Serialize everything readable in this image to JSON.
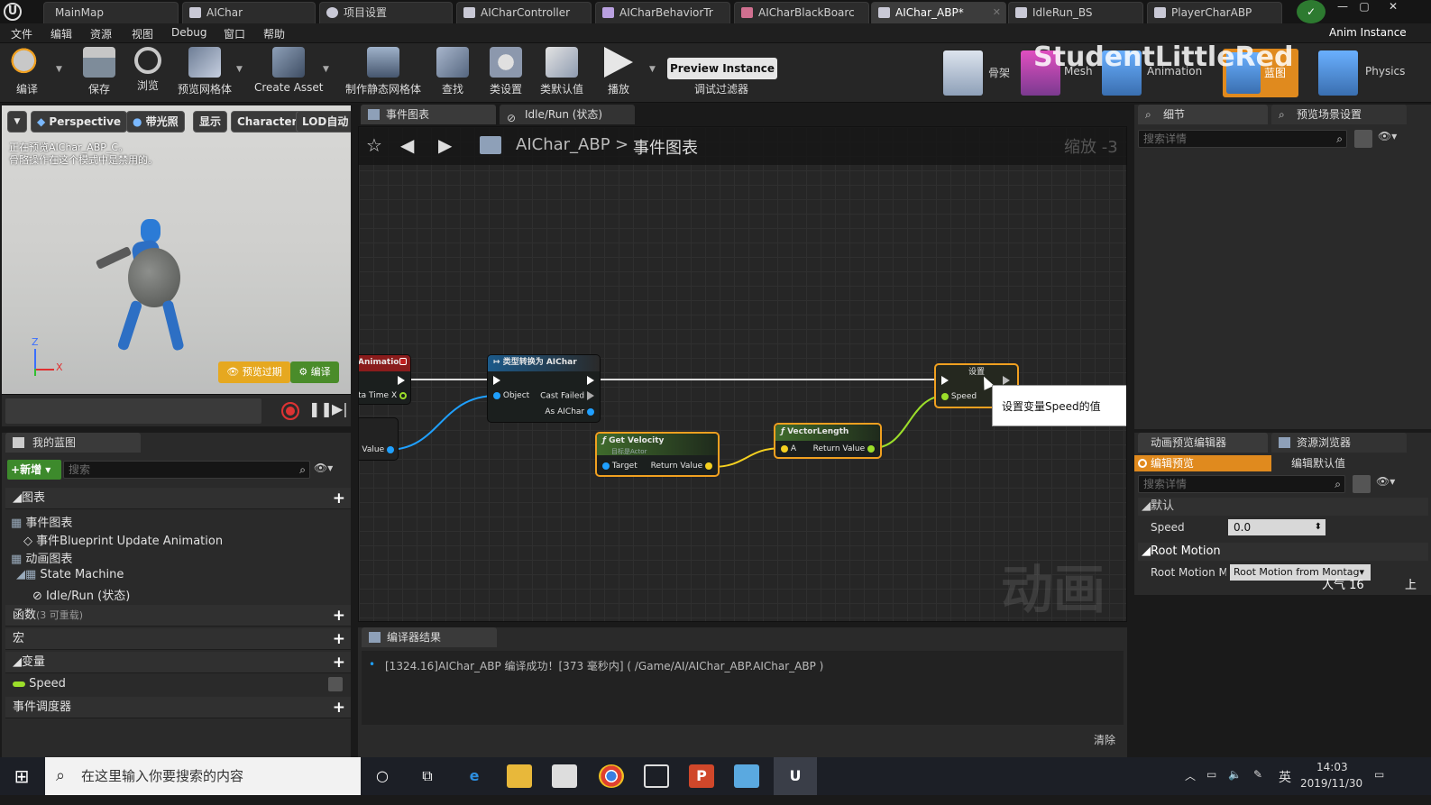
{
  "doc_tabs": [
    {
      "label": "MainMap"
    },
    {
      "label": "AIChar"
    },
    {
      "label": "项目设置"
    },
    {
      "label": "AICharController"
    },
    {
      "label": "AICharBehaviorTr"
    },
    {
      "label": "AICharBlackBoarc"
    },
    {
      "label": "AIChar_ABP*"
    },
    {
      "label": "IdleRun_BS"
    },
    {
      "label": "PlayerCharABP"
    }
  ],
  "menu": [
    "文件",
    "编辑",
    "资源",
    "视图",
    "Debug",
    "窗口",
    "帮助"
  ],
  "window_right_label": "Anim Instance",
  "watermark_text": "StudentLittleRed",
  "toolbar": {
    "buttons": [
      "编译",
      "保存",
      "浏览",
      "预览网格体",
      "Create Asset",
      "制作静态网格体",
      "查找",
      "类设置",
      "类默认值",
      "播放"
    ],
    "preview_instance": "Preview Instance ▾",
    "debug_filter": "调试过滤器",
    "modes": [
      "骨架",
      "Mesh",
      "Animation",
      "蓝图",
      "Physics"
    ]
  },
  "viewport": {
    "buttons": [
      "Perspective",
      "带光照",
      "显示",
      "Character",
      "LOD自动"
    ],
    "info_line1": "正在预览AIChar_ABP_C。",
    "info_line2": "骨骼操作在这个模式中是禁用的。",
    "axis_z": "Z",
    "axis_x": "X",
    "preview_expired": "预览过期",
    "compile_badge": "编译"
  },
  "my_blueprint": {
    "tab": "我的蓝图",
    "new_button": "新增 ▾",
    "search_placeholder": "搜索",
    "graphs_header": "图表",
    "event_graph": "事件图表",
    "event_item": "事件Blueprint Update Animation",
    "anim_graph": "动画图表",
    "state_machine": "State Machine",
    "idle_run": "Idle/Run (状态)",
    "functions_header": "函数",
    "functions_count": "(3 可重载)",
    "macros_header": "宏",
    "variables_header": "变量",
    "var_speed": "Speed",
    "dispatchers_header": "事件调度器"
  },
  "graph": {
    "tabs": [
      "事件图表",
      "Idle/Run (状态)"
    ],
    "breadcrumb_root": "AIChar_ABP",
    "breadcrumb_sep": ">",
    "breadcrumb_current": "事件图表",
    "zoom": "缩放 -3",
    "watermark": "动画",
    "tooltip": "设置变量Speed的值",
    "nodes": {
      "anim_partial": {
        "title": "Animation",
        "pin_label": "ta Time X"
      },
      "value_partial": {
        "pin_label": "Value"
      },
      "cast": {
        "title": "类型转换为 AIChar",
        "object": "Object",
        "cast_failed": "Cast Failed",
        "as_aichar": "As AIChar"
      },
      "get_velocity": {
        "title": "Get Velocity",
        "subtitle": "目标是Actor",
        "target": "Target",
        "return": "Return Value"
      },
      "vector_length": {
        "title": "VectorLength",
        "a": "A",
        "return": "Return Value"
      },
      "set": {
        "title": "设置",
        "speed": "Speed"
      }
    }
  },
  "compiler": {
    "tab": "编译器结果",
    "message": "[1324.16]AIChar_ABP 编译成功！[373 毫秒内] ( /Game/AI/AIChar_ABP.AIChar_ABP )",
    "clear": "清除"
  },
  "details": {
    "tabs": [
      "细节",
      "预览场景设置"
    ],
    "search_placeholder": "搜索详情"
  },
  "anim_preview": {
    "tabs": [
      "动画预览编辑器",
      "资源浏览器"
    ],
    "edit_preview": "编辑预览",
    "edit_defaults": "编辑默认值",
    "search_placeholder": "搜索详情",
    "default_section": "默认",
    "speed_label": "Speed",
    "speed_value": "0.0",
    "root_motion_section": "Root Motion",
    "root_motion_label": "Root Motion Mo",
    "root_motion_value": "Root Motion from Montag▾",
    "popularity": "人气 16",
    "overflow": "上"
  },
  "taskbar": {
    "search_text": "在这里输入你要搜索的内容",
    "ime": "英",
    "time": "14:03",
    "date": "2019/11/30"
  },
  "colors": {
    "accent_orange": "#f0a020",
    "exec_white": "#ffffff",
    "object_blue": "#1fa0ff",
    "vector_yellow": "#f5d020",
    "float_green": "#9cde2a"
  }
}
